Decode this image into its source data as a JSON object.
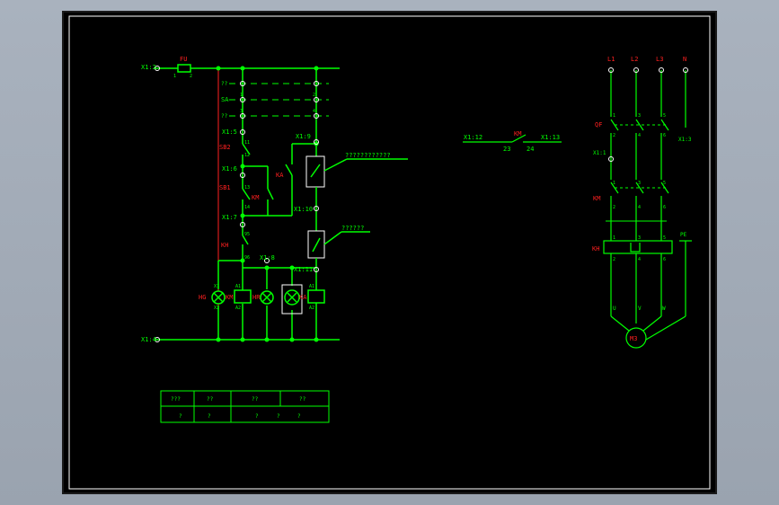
{
  "colors": {
    "background": "#a3acb8",
    "paper": "#000000",
    "border": "#ffffff",
    "wire": "#00ff00",
    "label_red": "#ff2020",
    "terminal_white": "#ffffff",
    "outer_frame": "#202020"
  },
  "left_circuit": {
    "top_rail_label": "X1:2",
    "bottom_rail_label": "X1:4",
    "fuse_label": "FU",
    "fuse_pin1": "1",
    "fuse_pin2": "2",
    "switch_row1_label": "??",
    "switch_row2_label": "SA",
    "switch_row3_label": "??",
    "switch_pin1": "1",
    "switch_pin2": "2",
    "switch_pin3": "3",
    "switch_pin4": "4",
    "x1_5": "X1:5",
    "x1_6": "X1:6",
    "x1_7": "X1:7",
    "x1_8": "X1:8",
    "x1_9": "X1:9",
    "x1_10": "X1:10",
    "x1_11": "X1:11",
    "sb2": "SB2",
    "sb1": "SB1",
    "km_contact": "KM",
    "ka_contact": "KA",
    "kh_contact": "KH",
    "hg": "HG",
    "hr": "HR",
    "km_coil": "KM",
    "ka_coil": "KA",
    "note1": "????????????",
    "note2": "??????",
    "n11": "11",
    "n12": "12",
    "n13": "13",
    "n14": "14",
    "n95": "95",
    "n96": "96",
    "n97": "97",
    "n98": "98",
    "a1": "A1",
    "a2": "A2",
    "x1": "X1",
    "x2": "X2"
  },
  "middle_contact": {
    "left": "X1:12",
    "center": "KM",
    "right": "X1:13",
    "pin23": "23",
    "pin24": "24"
  },
  "motor_circuit": {
    "phases": [
      "L1",
      "L2",
      "L3",
      "N"
    ],
    "qf": "QF",
    "x1_1": "X1:1",
    "x1_3": "X1:3",
    "km": "KM",
    "kh": "KH",
    "pe": "PE",
    "outputs": [
      "U",
      "V",
      "W"
    ],
    "motor": "M3",
    "pins_top": [
      "1",
      "3",
      "5"
    ],
    "pins_bottom": [
      "2",
      "4",
      "6"
    ]
  },
  "table": {
    "headers": [
      "???",
      "??",
      "??",
      "??"
    ],
    "cells": [
      "?",
      "?",
      "?",
      "?",
      "?"
    ]
  }
}
